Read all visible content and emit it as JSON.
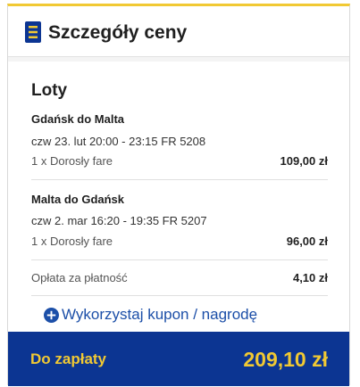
{
  "header": {
    "title": "Szczegóły ceny",
    "icon": "document-list-icon"
  },
  "section": {
    "title": "Loty"
  },
  "flights": [
    {
      "route": "Gdańsk do Malta",
      "details": "czw 23. lut 20:00 - 23:15 FR 5208",
      "fare_label": "1 x Dorosły fare",
      "fare_price": "109,00 zł"
    },
    {
      "route": "Malta do Gdańsk",
      "details": "czw 2. mar 16:20 - 19:35 FR 5207",
      "fare_label": "1 x Dorosły fare",
      "fare_price": "96,00 zł"
    }
  ],
  "fee": {
    "label": "Opłata za płatność",
    "price": "4,10 zł"
  },
  "coupon": {
    "label": "Wykorzystaj kupon / nagrodę",
    "icon": "plus-circle-icon"
  },
  "total": {
    "label": "Do zapłaty",
    "value": "209,10 zł"
  },
  "colors": {
    "brand_blue": "#0c3592",
    "accent_yellow": "#f1c933",
    "link_blue": "#1c4fa8"
  }
}
